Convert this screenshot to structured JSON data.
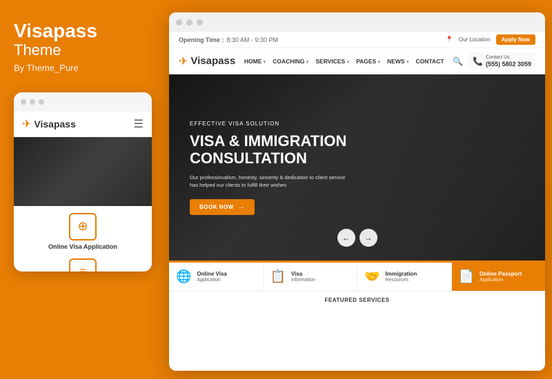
{
  "left": {
    "brand_name": "Visapass",
    "brand_sub": "Theme",
    "by_line": "By Theme_Pure",
    "mobile_logo": "Visapass",
    "service_label": "Online Visa Application"
  },
  "desktop": {
    "header_top": {
      "opening_time_label": "Opening Time :",
      "opening_time_value": "8:30 AM - 9:30 PM",
      "location_label": "Our Location",
      "apply_btn": "Apply Now"
    },
    "nav": {
      "logo": "Visapass",
      "links": [
        "HOME",
        "COACHING",
        "SERVICES",
        "PAGES",
        "NEWS",
        "CONTACT"
      ],
      "contact_us_label": "Contact Us",
      "phone": "(555) 5802 3059"
    },
    "hero": {
      "eyebrow": "EFFECTIVE VISA SOLUTION",
      "title_line1": "VISA & IMMIGRATION",
      "title_line2": "CONSULTATION",
      "description": "Our professionalism, honesty, sincerity & dedication to client service\nhas helped our clients to fulfill their wishes",
      "cta_btn": "BOOK NOW"
    },
    "services": [
      {
        "icon": "🌐",
        "title": "Online Visa",
        "sub": "Application"
      },
      {
        "icon": "📋",
        "title": "Visa",
        "sub": "Information"
      },
      {
        "icon": "🤝",
        "title": "Immigration",
        "sub": "Resources"
      },
      {
        "icon": "📄",
        "title": "Online Passport",
        "sub": "Application"
      }
    ],
    "featured_services_label": "FEATURED SERVICES"
  }
}
